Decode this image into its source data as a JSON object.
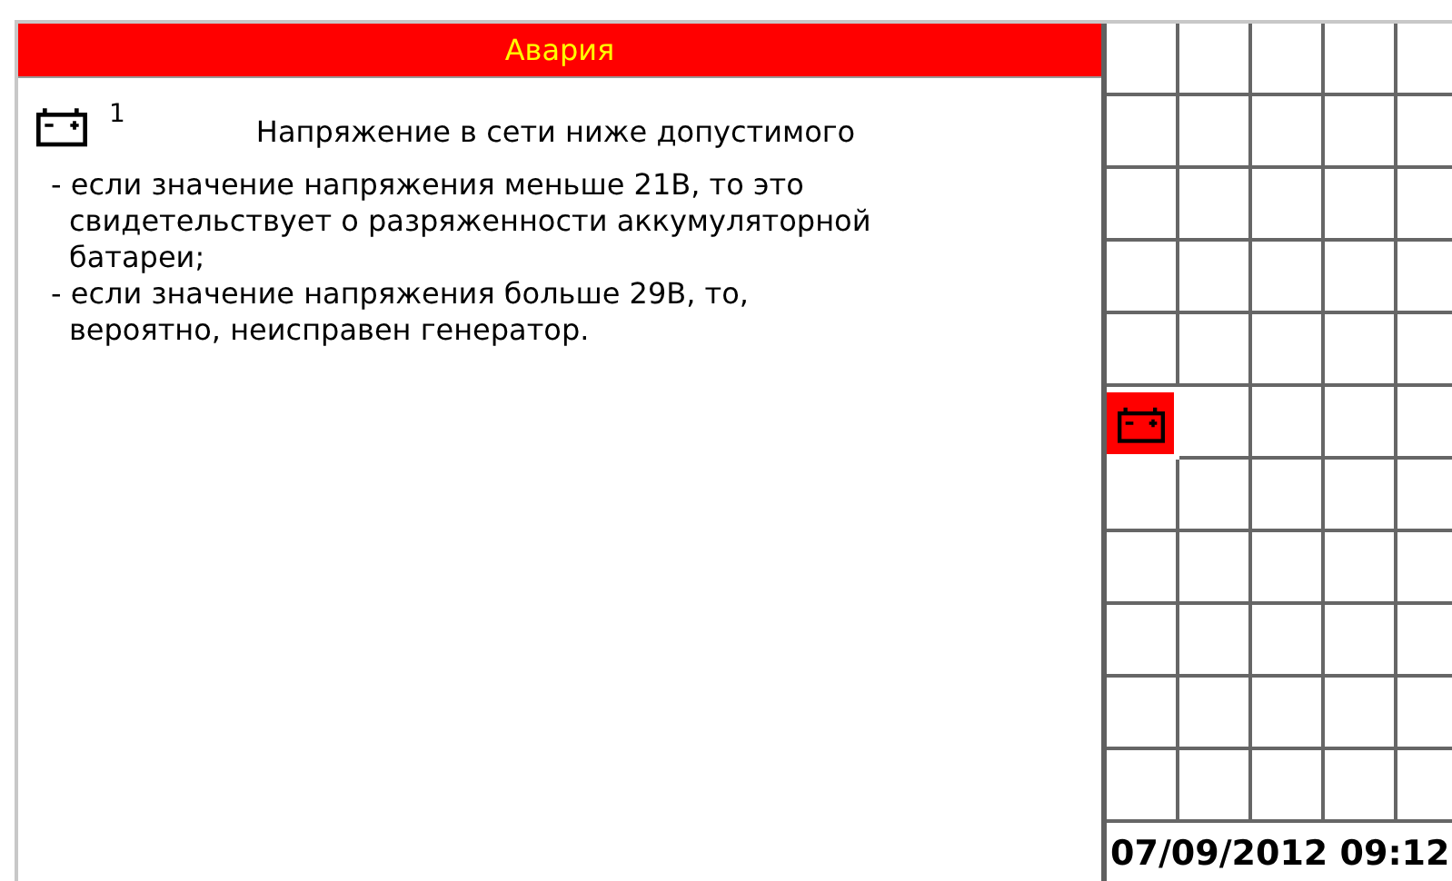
{
  "alarm": {
    "title": "Авария",
    "code": "1",
    "message": "Напряжение в сети ниже допустимого",
    "notes": [
      "- если значение напряжения меньше 21В, то это свидетельствует о разряженности аккумуляторной батареи;",
      "- если значение напряжения больше 29В, то, вероятно, неисправен генератор."
    ]
  },
  "grid": {
    "rows": [
      [
        {
          "active": false
        },
        {
          "active": false
        },
        {
          "active": false
        },
        {
          "active": false
        },
        {
          "active": false
        }
      ],
      [
        {
          "active": false
        },
        {
          "active": false
        },
        {
          "active": false
        },
        {
          "active": false
        },
        {
          "active": false
        }
      ],
      [
        {
          "active": false
        },
        {
          "active": false
        },
        {
          "active": false
        },
        {
          "active": false
        },
        {
          "active": false
        }
      ],
      [
        {
          "active": false
        },
        {
          "active": false
        },
        {
          "active": false
        },
        {
          "active": false
        },
        {
          "active": false
        }
      ],
      [
        {
          "active": false
        },
        {
          "active": false
        },
        {
          "active": false
        },
        {
          "active": false
        },
        {
          "active": false
        }
      ],
      [
        {
          "active": true
        },
        {
          "active": false
        },
        {
          "active": false
        },
        {
          "active": false
        },
        {
          "active": false
        }
      ],
      [
        {
          "active": false
        },
        {
          "active": false
        },
        {
          "active": false
        },
        {
          "active": false
        },
        {
          "active": false
        }
      ],
      [
        {
          "active": false
        },
        {
          "active": false
        },
        {
          "active": false
        },
        {
          "active": false
        },
        {
          "active": false
        }
      ],
      [
        {
          "active": false
        },
        {
          "active": false
        },
        {
          "active": false
        },
        {
          "active": false
        },
        {
          "active": false
        }
      ],
      [
        {
          "active": false
        },
        {
          "active": false
        },
        {
          "active": false
        },
        {
          "active": false
        },
        {
          "active": false
        }
      ],
      [
        {
          "active": false
        },
        {
          "active": false
        },
        {
          "active": false
        },
        {
          "active": false
        },
        {
          "active": false
        }
      ]
    ],
    "datetime": "07/09/2012 09:12"
  }
}
